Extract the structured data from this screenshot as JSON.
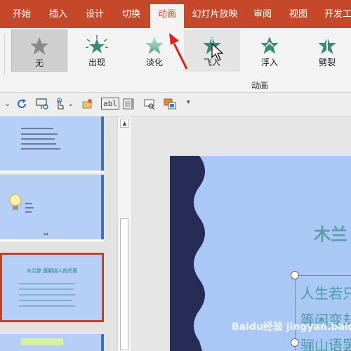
{
  "ribbon_tabs": [
    "开始",
    "插入",
    "设计",
    "切换",
    "动画",
    "幻灯片放映",
    "审阅",
    "视图",
    "开发工"
  ],
  "active_tab": "动画",
  "effects": [
    {
      "label": "无",
      "icon": "star-gray-icon",
      "state": "selected"
    },
    {
      "label": "出现",
      "icon": "star-burst-icon",
      "state": "normal"
    },
    {
      "label": "淡化",
      "icon": "star-fade-icon",
      "state": "normal"
    },
    {
      "label": "飞入",
      "icon": "star-fly-icon",
      "state": "hover"
    },
    {
      "label": "浮入",
      "icon": "star-float-icon",
      "state": "normal"
    },
    {
      "label": "劈裂",
      "icon": "star-split-icon",
      "state": "normal"
    }
  ],
  "group_label": "动画",
  "toolbar": {
    "abl": "abl"
  },
  "slides_pane": {
    "slide3_title": "木兰辞 唐朝诗人的代表",
    "slide3_number": "↔"
  },
  "canvas": {
    "title": "木兰",
    "lines": [
      "人生若只",
      "等闲变却",
      "骊山语罢"
    ]
  },
  "colors": {
    "ribbon": "#c5482a",
    "slide_bg": "#a9c8f6",
    "slide_dark": "#262c55",
    "title_text": "#5a9eaa",
    "arrow": "#e02020",
    "star_teal": "#3d8a74"
  },
  "watermark": "Baidu经验 jingyan.baidu.com"
}
